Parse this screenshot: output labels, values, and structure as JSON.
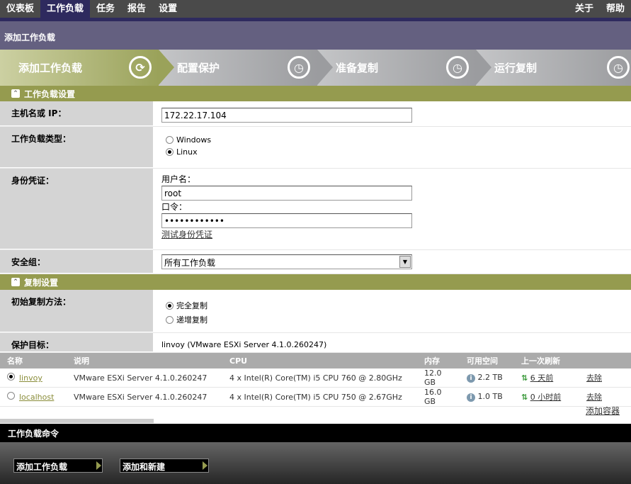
{
  "nav": {
    "items": [
      "仪表板",
      "工作负载",
      "任务",
      "报告",
      "设置"
    ],
    "right": [
      "关于",
      "帮助"
    ]
  },
  "header": {
    "title": "添加工作负载"
  },
  "steps": [
    "添加工作负载",
    "配置保护",
    "准备复制",
    "运行复制"
  ],
  "workload_settings": {
    "title": "工作负载设置",
    "host_label": "主机名或 IP：",
    "host_value": "172.22.17.104",
    "type_label": "工作负载类型：",
    "type_options": [
      "Windows",
      "Linux"
    ],
    "cred_label": "身份凭证：",
    "username_label": "用户名：",
    "username_value": "root",
    "password_label": "口令：",
    "password_value": "••••••••••••",
    "test_link": "测试身份凭证",
    "group_label": "安全组：",
    "group_value": "所有工作负载"
  },
  "replication_settings": {
    "title": "复制设置",
    "method_label": "初始复制方法：",
    "method_options": [
      "完全复制",
      "递增复制"
    ],
    "target_label": "保护目标：",
    "target_value": "linvoy (VMware ESXi Server 4.1.0.260247)"
  },
  "table": {
    "headers": [
      "名称",
      "说明",
      "CPU",
      "内存",
      "可用空间",
      "上一次刷新",
      ""
    ],
    "rows": [
      {
        "name": "linvoy",
        "desc": "VMware ESXi Server 4.1.0.260247",
        "cpu": "4 x Intel(R) Core(TM) i5 CPU 760 @ 2.80GHz",
        "mem": "12.0 GB",
        "free": "2.2 TB",
        "refresh": "6 天前",
        "action": "去除"
      },
      {
        "name": "localhost",
        "desc": "VMware ESXi Server 4.1.0.260247",
        "cpu": "4 x Intel(R) Core(TM) i5 CPU 750 @ 2.67GHz",
        "mem": "16.0 GB",
        "free": "1.0 TB",
        "refresh": "0 小时前",
        "action": "去除"
      }
    ],
    "add_container": "添加容器"
  },
  "commands": {
    "title": "工作负载命令",
    "buttons": [
      "添加工作负载",
      "添加和新建"
    ]
  }
}
